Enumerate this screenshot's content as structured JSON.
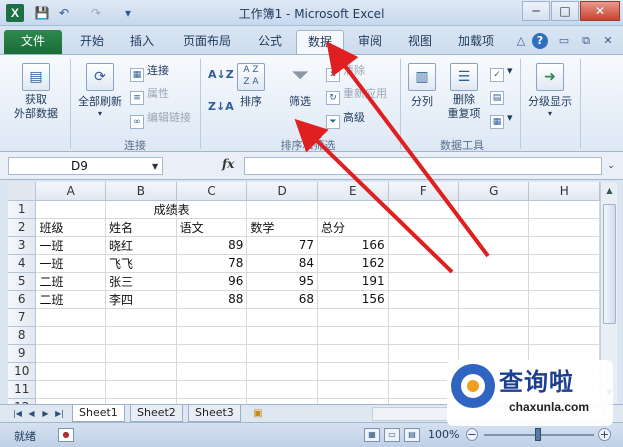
{
  "window": {
    "title": "工作簿1 - Microsoft Excel",
    "app_logo": "X",
    "minimize": "─",
    "maximize": "□",
    "close": "✕"
  },
  "quick_access": {
    "save_icon": "💾",
    "undo_icon": "↶",
    "redo_icon": "↷",
    "customize_icon": "▾"
  },
  "tabs": {
    "file": "文件",
    "items": [
      "开始",
      "插入",
      "页面布局",
      "公式",
      "数据",
      "审阅",
      "视图",
      "加载项"
    ],
    "active": "数据"
  },
  "ribbon": {
    "connections_group": {
      "label": "连接",
      "get_external": "获取\n外部数据",
      "refresh_all": "全部刷新",
      "connections": "连接",
      "properties": "属性",
      "edit_links": "编辑链接"
    },
    "sort_filter_group": {
      "label": "排序和筛选",
      "sort": "排序",
      "filter": "筛选",
      "clear": "清除",
      "reapply": "重新应用",
      "advanced": "高级"
    },
    "data_tools_group": {
      "label": "数据工具",
      "text_to_columns": "分列",
      "remove_duplicates": "删除\n重复项"
    },
    "outline_group": {
      "outline": "分级显示"
    }
  },
  "formula_bar": {
    "name_box": "D9",
    "fx": "fx",
    "formula": ""
  },
  "sheet": {
    "columns": [
      "A",
      "B",
      "C",
      "D",
      "E",
      "F",
      "G",
      "H"
    ],
    "rows": [
      "1",
      "2",
      "3",
      "4",
      "5",
      "6",
      "7",
      "8",
      "9",
      "10",
      "11",
      "12"
    ],
    "title": "成绩表",
    "headers": [
      "班级",
      "姓名",
      "语文",
      "数学",
      "总分"
    ],
    "data": [
      [
        "一班",
        "晓红",
        "89",
        "77",
        "166"
      ],
      [
        "一班",
        "飞飞",
        "78",
        "84",
        "162"
      ],
      [
        "二班",
        "张三",
        "96",
        "95",
        "191"
      ],
      [
        "二班",
        "李四",
        "88",
        "68",
        "156"
      ]
    ]
  },
  "sheet_tabs": [
    "Sheet1",
    "Sheet2",
    "Sheet3"
  ],
  "status": {
    "text": "就绪",
    "zoom": "100%",
    "zoom_out": "−",
    "zoom_in": "+"
  },
  "watermark": {
    "title": "查询啦",
    "url": "chaxunla.com"
  },
  "colors": {
    "file_tab": "#1c6b38",
    "arrow": "#e02020",
    "watermark_blue": "#2f64c2"
  }
}
